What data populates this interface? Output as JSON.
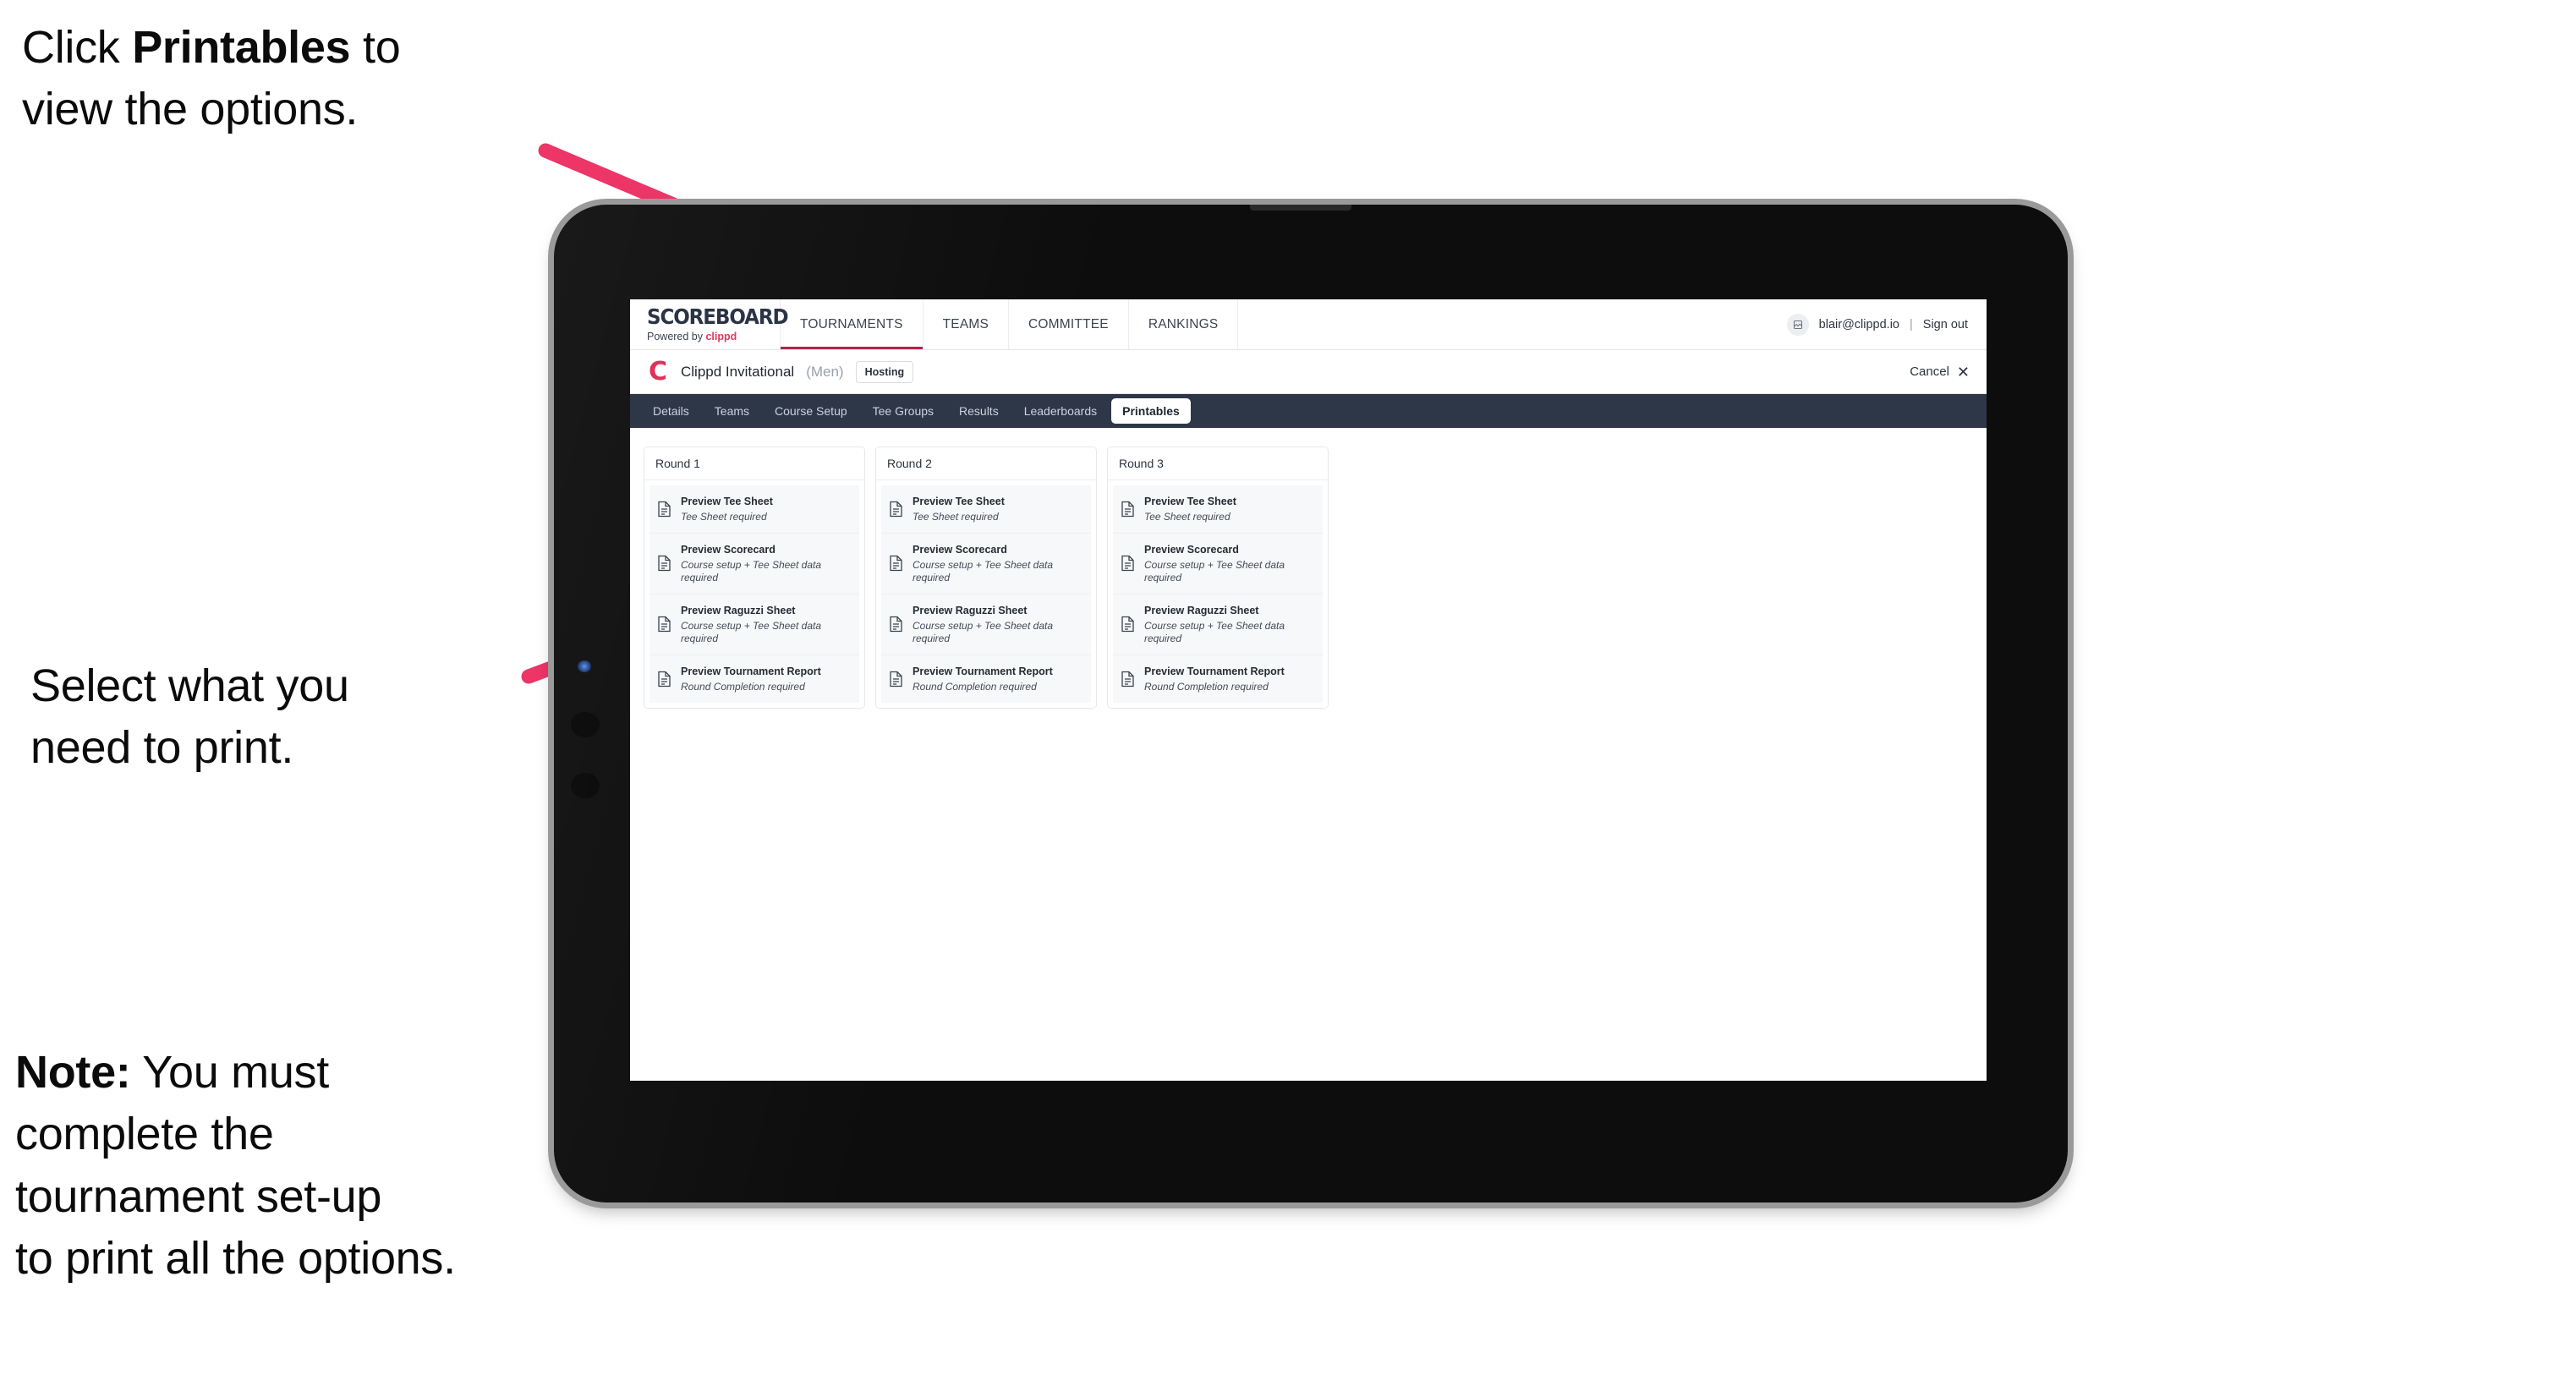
{
  "annotations": {
    "top": {
      "pre": "Click ",
      "bold": "Printables",
      "post": " to\nview the options."
    },
    "middle": "Select what you\n need to print.",
    "note": {
      "bold": "Note:",
      "rest": " You must\ncomplete the\ntournament set-up\nto print all the options."
    }
  },
  "colors": {
    "arrow_pink": "#EE3567",
    "accent_crimson": "#b32246",
    "brand_red": "#e0385f",
    "tabstrip_dark": "#2e3748",
    "tablet_body": "#0d0d0d",
    "tablet_edge": "#9a9a9a"
  },
  "app": {
    "logo": {
      "wordmark": "SCOREBOARD",
      "powered_prefix": "Powered by ",
      "powered_brand": "clippd"
    },
    "nav": {
      "tabs": [
        {
          "label": "TOURNAMENTS",
          "active": true
        },
        {
          "label": "TEAMS",
          "active": false
        },
        {
          "label": "COMMITTEE",
          "active": false
        },
        {
          "label": "RANKINGS",
          "active": false
        }
      ],
      "avatar_icon": "user-avatar-icon",
      "email": "blair@clippd.io",
      "separator": "|",
      "sign_out": "Sign out"
    },
    "tournament": {
      "logo_glyph": "C",
      "name": "Clippd Invitational",
      "gender": "(Men)",
      "badge": "Hosting",
      "cancel_label": "Cancel",
      "cancel_icon": "close-icon"
    },
    "section_tabs": [
      {
        "label": "Details",
        "active": false
      },
      {
        "label": "Teams",
        "active": false
      },
      {
        "label": "Course Setup",
        "active": false
      },
      {
        "label": "Tee Groups",
        "active": false
      },
      {
        "label": "Results",
        "active": false
      },
      {
        "label": "Leaderboards",
        "active": false
      },
      {
        "label": "Printables",
        "active": true
      }
    ],
    "rounds": [
      {
        "title": "Round 1",
        "items": [
          {
            "title": "Preview Tee Sheet",
            "sub": "Tee Sheet required"
          },
          {
            "title": "Preview Scorecard",
            "sub": "Course setup + Tee Sheet data required"
          },
          {
            "title": "Preview Raguzzi Sheet",
            "sub": "Course setup + Tee Sheet data required"
          },
          {
            "title": "Preview Tournament Report",
            "sub": "Round Completion required"
          }
        ]
      },
      {
        "title": "Round 2",
        "items": [
          {
            "title": "Preview Tee Sheet",
            "sub": "Tee Sheet required"
          },
          {
            "title": "Preview Scorecard",
            "sub": "Course setup + Tee Sheet data required"
          },
          {
            "title": "Preview Raguzzi Sheet",
            "sub": "Course setup + Tee Sheet data required"
          },
          {
            "title": "Preview Tournament Report",
            "sub": "Round Completion required"
          }
        ]
      },
      {
        "title": "Round 3",
        "items": [
          {
            "title": "Preview Tee Sheet",
            "sub": "Tee Sheet required"
          },
          {
            "title": "Preview Scorecard",
            "sub": "Course setup + Tee Sheet data required"
          },
          {
            "title": "Preview Raguzzi Sheet",
            "sub": "Course setup + Tee Sheet data required"
          },
          {
            "title": "Preview Tournament Report",
            "sub": "Round Completion required"
          }
        ]
      }
    ]
  }
}
